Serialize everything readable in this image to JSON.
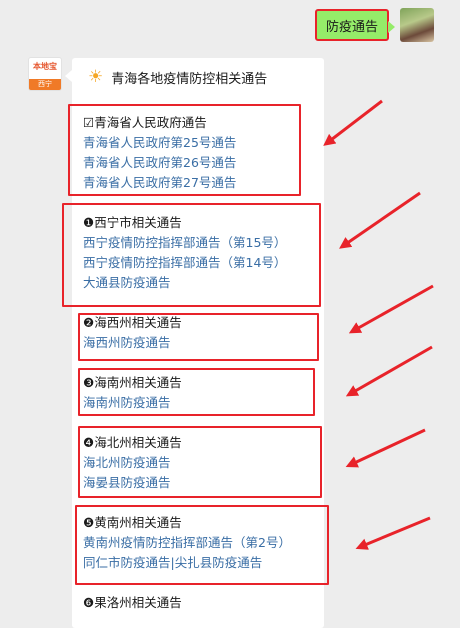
{
  "user_message": "防疫通告",
  "bot_avatar": {
    "brand": "本地宝",
    "tag": "西宁"
  },
  "title": "青海各地疫情防控相关通告",
  "sections": [
    {
      "head": "☑青海省人民政府通告",
      "links": [
        "青海省人民政府第25号通告",
        "青海省人民政府第26号通告",
        "青海省人民政府第27号通告"
      ]
    },
    {
      "head": "❶西宁市相关通告",
      "links": [
        "西宁疫情防控指挥部通告（第15号）",
        "西宁疫情防控指挥部通告（第14号）",
        "大通县防疫通告"
      ]
    },
    {
      "head": "❷海西州相关通告",
      "links": [
        "海西州防疫通告"
      ]
    },
    {
      "head": "❸海南州相关通告",
      "links": [
        "海南州防疫通告"
      ]
    },
    {
      "head": "❹海北州相关通告",
      "links": [
        "海北州防疫通告",
        "海晏县防疫通告"
      ]
    },
    {
      "head": "❺黄南州相关通告",
      "links": [
        "黄南州疫情防控指挥部通告（第2号）",
        "同仁市防疫通告|尖扎县防疫通告"
      ]
    },
    {
      "head": "❻果洛州相关通告",
      "links": []
    }
  ],
  "colors": {
    "highlight": "#e8232a",
    "link": "#3a6ea5",
    "bubble": "#95ec69"
  }
}
